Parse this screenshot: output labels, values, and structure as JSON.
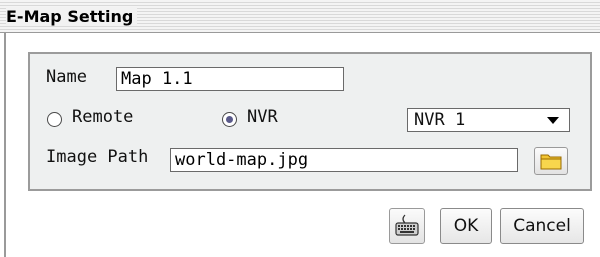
{
  "dialog": {
    "title": "E-Map Setting"
  },
  "form": {
    "name_label": "Name",
    "name_value": "Map 1.1",
    "source": {
      "remote_label": "Remote",
      "nvr_label": "NVR",
      "selected": "NVR"
    },
    "nvr_select": {
      "selected_value": "NVR 1"
    },
    "image_path_label": "Image Path",
    "image_path_value": "world-map.jpg"
  },
  "buttons": {
    "keyboard_icon": "keyboard-icon",
    "folder_icon": "folder-icon",
    "ok_label": "OK",
    "cancel_label": "Cancel"
  },
  "colors": {
    "group_background": "#eef0f0",
    "folder_yellow": "#f2c431"
  }
}
